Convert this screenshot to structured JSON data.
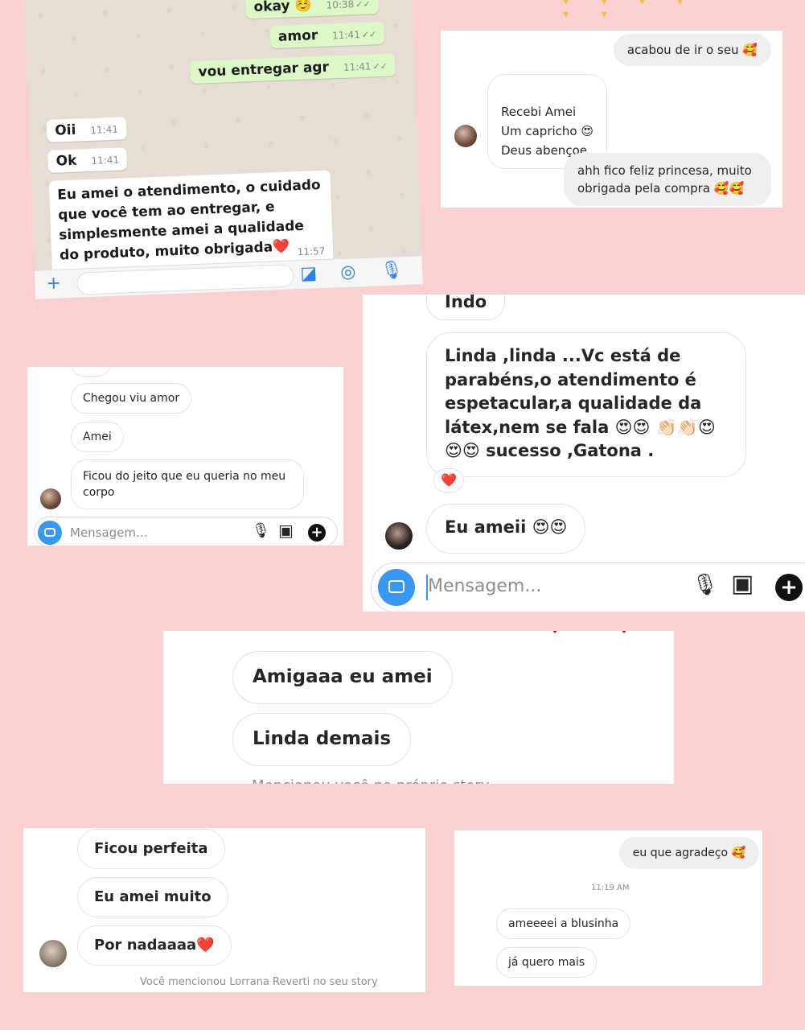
{
  "whatsapp": {
    "messages": [
      {
        "text": "okay ☺️",
        "time": "10:38",
        "dir": "out"
      },
      {
        "text": "amor",
        "time": "11:41",
        "dir": "out"
      },
      {
        "text": "vou entregar agr",
        "time": "11:41",
        "dir": "out"
      },
      {
        "text": "Oii",
        "time": "11:41",
        "dir": "in"
      },
      {
        "text": "Ok",
        "time": "11:41",
        "dir": "in"
      },
      {
        "text": "Eu amei o atendimento, o cuidado que você tem ao entregar, e simplesmente amei a qualidade do produto, muito obrigada❤️",
        "time": "11:57",
        "dir": "in"
      }
    ]
  },
  "chat_top_right": {
    "messages": [
      {
        "text": "acabou de ir o seu 🥰",
        "dir": "me"
      },
      {
        "text": "Recebi Amei\nUm capricho 😍\nDeus abençoe",
        "dir": "them"
      },
      {
        "text": "ahh fico feliz princesa, muito obrigada pela compra 🥰🥰",
        "dir": "me"
      }
    ]
  },
  "chat_mid_left": {
    "messages": [
      {
        "text": "Chegou viu amor"
      },
      {
        "text": "Amei"
      },
      {
        "text": "Ficou do jeito que eu queria no meu corpo"
      }
    ],
    "placeholder": "Mensagem..."
  },
  "chat_mid_right": {
    "partial": "Indo",
    "long_message": "Linda ,linda ...Vc está de parabéns,o atendimento é espetacular,a qualidade da látex,nem se fala 😍😍 👏🏻👏🏻😍😍😍 sucesso ,Gatona .",
    "reaction": "❤️",
    "short_message": "Eu ameii 😍😍",
    "placeholder": "Mensagem..."
  },
  "chat_center": {
    "messages": [
      {
        "text": "Amigaaa eu amei"
      },
      {
        "text": "Linda demais"
      }
    ],
    "cut_text": "Mencionou você no próprio story"
  },
  "chat_bottom_left": {
    "messages": [
      {
        "text": "Ficou perfeita"
      },
      {
        "text": "Eu amei muito"
      },
      {
        "text": "Por nadaaaa❤️"
      }
    ],
    "footer": "Você mencionou Lorrana Reverti no seu story"
  },
  "chat_bottom_right": {
    "me_message": "eu que agradeço 🥰",
    "timestamp": "11:19 AM",
    "messages": [
      {
        "text": "ameeeei a blusinha"
      },
      {
        "text": "já quero mais"
      }
    ]
  },
  "colors": {
    "background": "#fbd0d0",
    "whatsapp_out": "#dcf8c6",
    "instagram_blue": "#3897f0"
  }
}
